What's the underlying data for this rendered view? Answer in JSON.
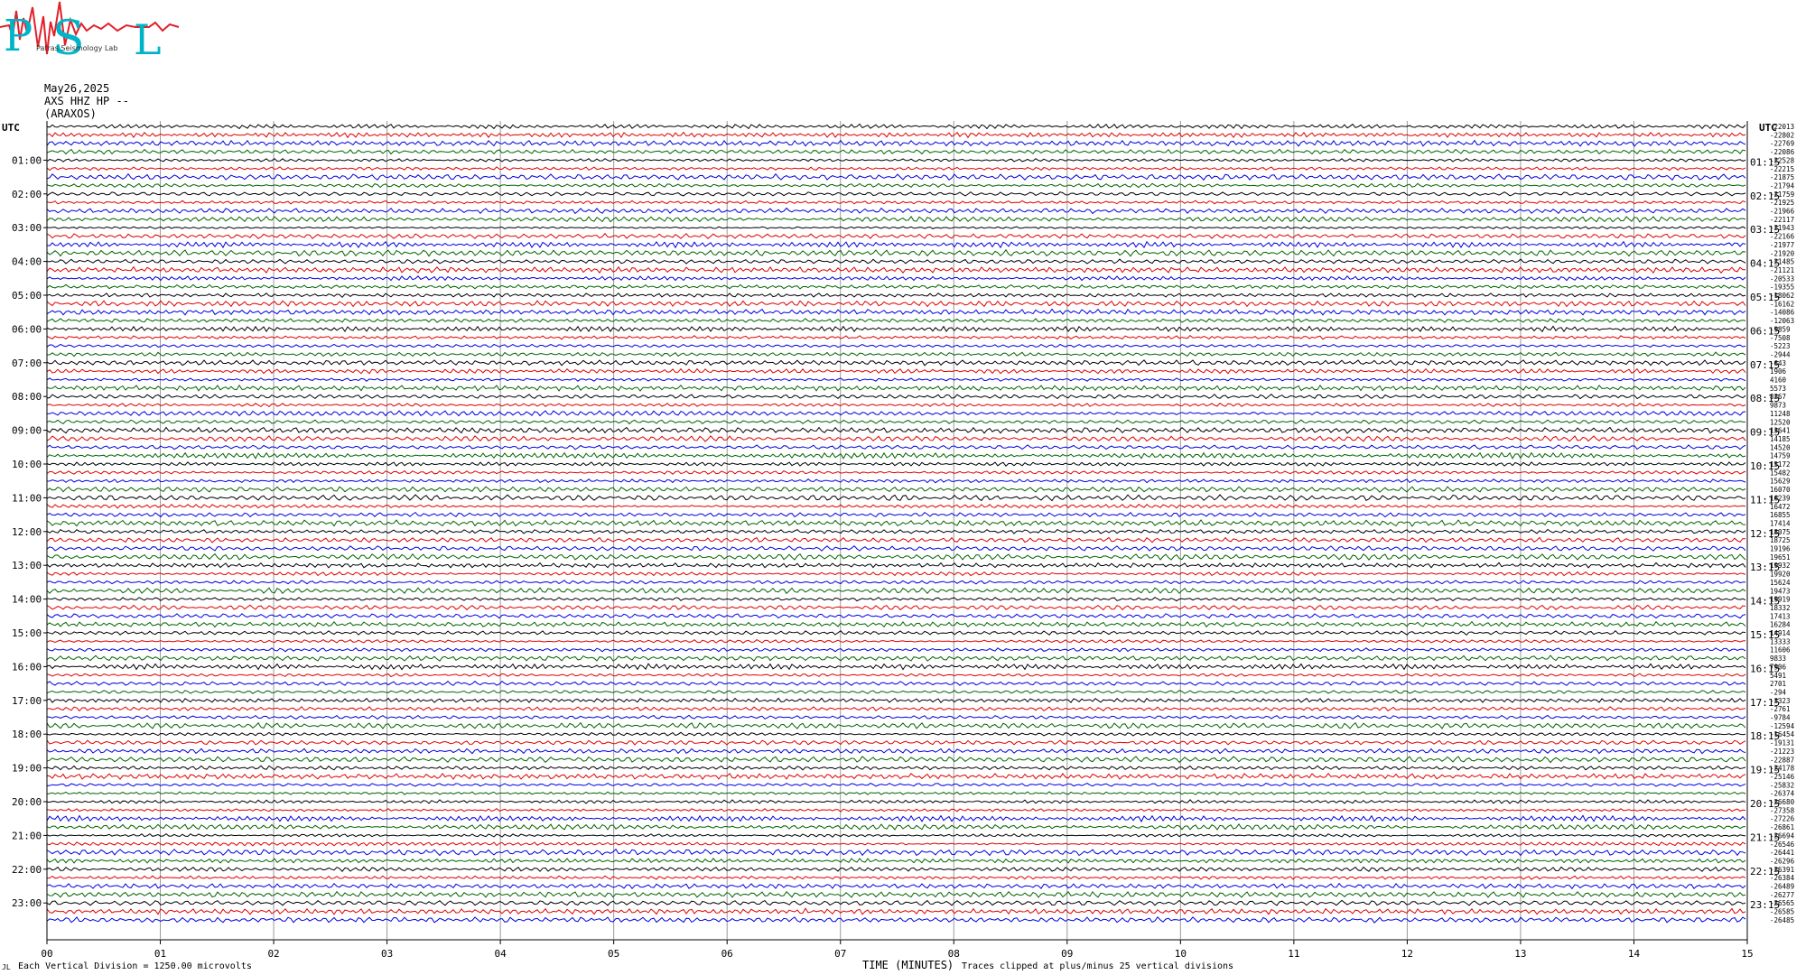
{
  "header": {
    "date": "May26,2025",
    "station": "AXS HHZ HP --",
    "location": "(ARAXOS)"
  },
  "logo": {
    "letters": "PSL",
    "text": "Patras Seismology Lab",
    "colors": {
      "letters": "#00b4c8",
      "wave": "#e0202a"
    }
  },
  "footer": {
    "scale_note": "Each Vertical Division = 1250.00 microvolts",
    "xlabel": "TIME (MINUTES)",
    "clip_note": "Traces clipped at plus/minus 25 vertical divisions",
    "corner": "JL"
  },
  "chart_data": {
    "type": "line",
    "title": "",
    "xlabel": "TIME (MINUTES)",
    "ylabel": "UTC",
    "xlim": [
      0,
      15
    ],
    "x_ticks": [
      "00",
      "01",
      "02",
      "03",
      "04",
      "05",
      "06",
      "07",
      "08",
      "09",
      "10",
      "11",
      "12",
      "13",
      "14",
      "15"
    ],
    "left_axis_label": "UTC",
    "right_axis_label": "UTC",
    "left_labels": [
      "01:00",
      "02:00",
      "03:00",
      "04:00",
      "05:00",
      "06:00",
      "07:00",
      "08:00",
      "09:00",
      "10:00",
      "11:00",
      "12:00",
      "13:00",
      "14:00",
      "15:00",
      "16:00",
      "17:00",
      "18:00",
      "19:00",
      "20:00",
      "21:00",
      "22:00",
      "23:00"
    ],
    "right_labels": [
      "01:15",
      "02:15",
      "03:15",
      "04:15",
      "05:15",
      "06:15",
      "07:15",
      "08:15",
      "09:15",
      "10:15",
      "11:15",
      "12:15",
      "13:15",
      "14:15",
      "15:15",
      "16:15",
      "17:15",
      "18:15",
      "19:15",
      "20:15",
      "21:15",
      "22:15",
      "23:15"
    ],
    "trace_colors": [
      "#000000",
      "#e00000",
      "#0000e0",
      "#006400"
    ],
    "trace_offsets": [
      -22013,
      -22802,
      -22769,
      -22086,
      -22528,
      -22215,
      -21875,
      -21794,
      -21759,
      -21925,
      -21966,
      -22117,
      -21943,
      -22166,
      -21977,
      -21920,
      -21485,
      -21121,
      -20533,
      -19355,
      -18062,
      -16162,
      -14086,
      -12063,
      -9859,
      -7508,
      -5223,
      -2944,
      -643,
      1906,
      4160,
      5573,
      8267,
      9873,
      11248,
      12520,
      13641,
      14185,
      14520,
      14759,
      15172,
      15482,
      15629,
      16070,
      16239,
      16472,
      16855,
      17414,
      18075,
      18725,
      19196,
      19651,
      19932,
      19920,
      15624,
      19473,
      19919,
      18332,
      17413,
      16284,
      14914,
      13333,
      11606,
      9833,
      7906,
      5491,
      2701,
      -294,
      -3323,
      -2761,
      -9784,
      -12594,
      -16454,
      -19131,
      -21223,
      -22887,
      -24178,
      -25146,
      -25832,
      -26374,
      -26680,
      -27358,
      -27226,
      -26861,
      -26694,
      -26546,
      -26441,
      -26296,
      -26391,
      -26384,
      -26489,
      -26277,
      -26565,
      -26585,
      -26485
    ]
  }
}
